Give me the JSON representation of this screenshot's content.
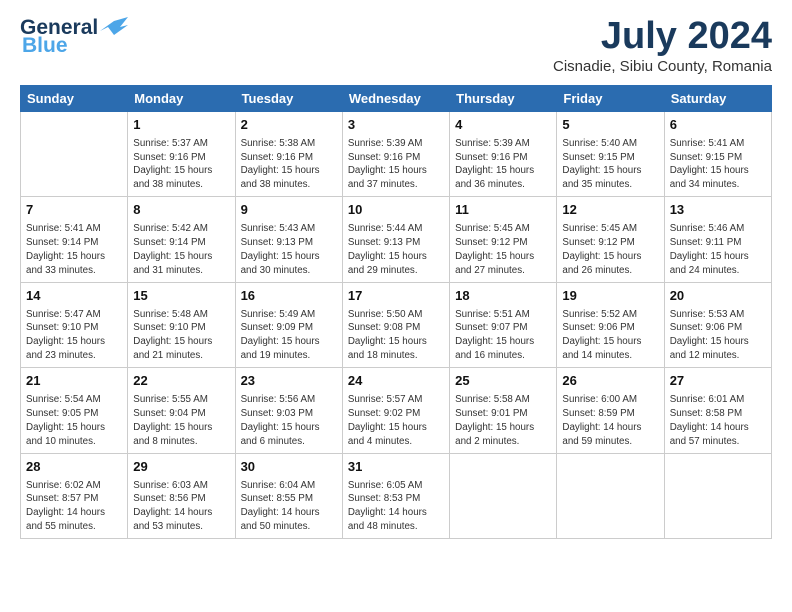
{
  "header": {
    "logo_line1": "General",
    "logo_line2": "Blue",
    "month_title": "July 2024",
    "location": "Cisnadie, Sibiu County, Romania"
  },
  "weekdays": [
    "Sunday",
    "Monday",
    "Tuesday",
    "Wednesday",
    "Thursday",
    "Friday",
    "Saturday"
  ],
  "weeks": [
    [
      {
        "day": "",
        "info": ""
      },
      {
        "day": "1",
        "info": "Sunrise: 5:37 AM\nSunset: 9:16 PM\nDaylight: 15 hours\nand 38 minutes."
      },
      {
        "day": "2",
        "info": "Sunrise: 5:38 AM\nSunset: 9:16 PM\nDaylight: 15 hours\nand 38 minutes."
      },
      {
        "day": "3",
        "info": "Sunrise: 5:39 AM\nSunset: 9:16 PM\nDaylight: 15 hours\nand 37 minutes."
      },
      {
        "day": "4",
        "info": "Sunrise: 5:39 AM\nSunset: 9:16 PM\nDaylight: 15 hours\nand 36 minutes."
      },
      {
        "day": "5",
        "info": "Sunrise: 5:40 AM\nSunset: 9:15 PM\nDaylight: 15 hours\nand 35 minutes."
      },
      {
        "day": "6",
        "info": "Sunrise: 5:41 AM\nSunset: 9:15 PM\nDaylight: 15 hours\nand 34 minutes."
      }
    ],
    [
      {
        "day": "7",
        "info": "Sunrise: 5:41 AM\nSunset: 9:14 PM\nDaylight: 15 hours\nand 33 minutes."
      },
      {
        "day": "8",
        "info": "Sunrise: 5:42 AM\nSunset: 9:14 PM\nDaylight: 15 hours\nand 31 minutes."
      },
      {
        "day": "9",
        "info": "Sunrise: 5:43 AM\nSunset: 9:13 PM\nDaylight: 15 hours\nand 30 minutes."
      },
      {
        "day": "10",
        "info": "Sunrise: 5:44 AM\nSunset: 9:13 PM\nDaylight: 15 hours\nand 29 minutes."
      },
      {
        "day": "11",
        "info": "Sunrise: 5:45 AM\nSunset: 9:12 PM\nDaylight: 15 hours\nand 27 minutes."
      },
      {
        "day": "12",
        "info": "Sunrise: 5:45 AM\nSunset: 9:12 PM\nDaylight: 15 hours\nand 26 minutes."
      },
      {
        "day": "13",
        "info": "Sunrise: 5:46 AM\nSunset: 9:11 PM\nDaylight: 15 hours\nand 24 minutes."
      }
    ],
    [
      {
        "day": "14",
        "info": "Sunrise: 5:47 AM\nSunset: 9:10 PM\nDaylight: 15 hours\nand 23 minutes."
      },
      {
        "day": "15",
        "info": "Sunrise: 5:48 AM\nSunset: 9:10 PM\nDaylight: 15 hours\nand 21 minutes."
      },
      {
        "day": "16",
        "info": "Sunrise: 5:49 AM\nSunset: 9:09 PM\nDaylight: 15 hours\nand 19 minutes."
      },
      {
        "day": "17",
        "info": "Sunrise: 5:50 AM\nSunset: 9:08 PM\nDaylight: 15 hours\nand 18 minutes."
      },
      {
        "day": "18",
        "info": "Sunrise: 5:51 AM\nSunset: 9:07 PM\nDaylight: 15 hours\nand 16 minutes."
      },
      {
        "day": "19",
        "info": "Sunrise: 5:52 AM\nSunset: 9:06 PM\nDaylight: 15 hours\nand 14 minutes."
      },
      {
        "day": "20",
        "info": "Sunrise: 5:53 AM\nSunset: 9:06 PM\nDaylight: 15 hours\nand 12 minutes."
      }
    ],
    [
      {
        "day": "21",
        "info": "Sunrise: 5:54 AM\nSunset: 9:05 PM\nDaylight: 15 hours\nand 10 minutes."
      },
      {
        "day": "22",
        "info": "Sunrise: 5:55 AM\nSunset: 9:04 PM\nDaylight: 15 hours\nand 8 minutes."
      },
      {
        "day": "23",
        "info": "Sunrise: 5:56 AM\nSunset: 9:03 PM\nDaylight: 15 hours\nand 6 minutes."
      },
      {
        "day": "24",
        "info": "Sunrise: 5:57 AM\nSunset: 9:02 PM\nDaylight: 15 hours\nand 4 minutes."
      },
      {
        "day": "25",
        "info": "Sunrise: 5:58 AM\nSunset: 9:01 PM\nDaylight: 15 hours\nand 2 minutes."
      },
      {
        "day": "26",
        "info": "Sunrise: 6:00 AM\nSunset: 8:59 PM\nDaylight: 14 hours\nand 59 minutes."
      },
      {
        "day": "27",
        "info": "Sunrise: 6:01 AM\nSunset: 8:58 PM\nDaylight: 14 hours\nand 57 minutes."
      }
    ],
    [
      {
        "day": "28",
        "info": "Sunrise: 6:02 AM\nSunset: 8:57 PM\nDaylight: 14 hours\nand 55 minutes."
      },
      {
        "day": "29",
        "info": "Sunrise: 6:03 AM\nSunset: 8:56 PM\nDaylight: 14 hours\nand 53 minutes."
      },
      {
        "day": "30",
        "info": "Sunrise: 6:04 AM\nSunset: 8:55 PM\nDaylight: 14 hours\nand 50 minutes."
      },
      {
        "day": "31",
        "info": "Sunrise: 6:05 AM\nSunset: 8:53 PM\nDaylight: 14 hours\nand 48 minutes."
      },
      {
        "day": "",
        "info": ""
      },
      {
        "day": "",
        "info": ""
      },
      {
        "day": "",
        "info": ""
      }
    ]
  ]
}
